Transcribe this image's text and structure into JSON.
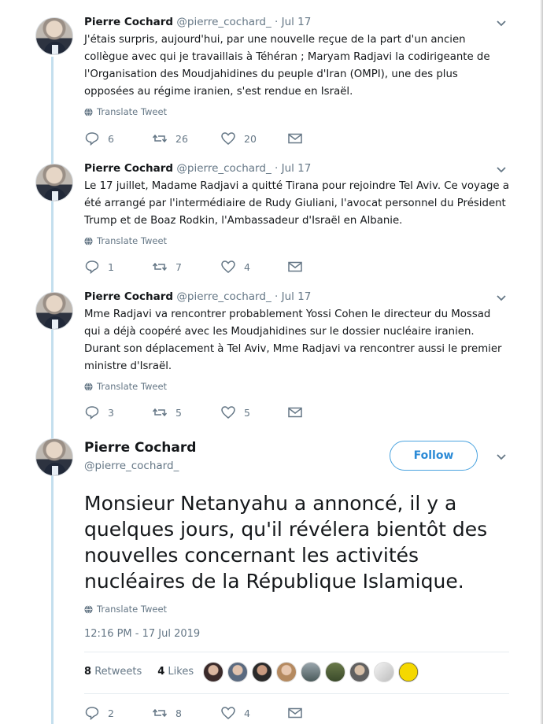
{
  "tweets": [
    {
      "name": "Pierre Cochard",
      "handle": "@pierre_cochard_",
      "date": "Jul 17",
      "text": "J'étais surpris, aujourd'hui, par une nouvelle reçue de la part d'un ancien collègue avec qui je travaillais à Téhéran ; Maryam Radjavi la codirigeante de l'Organisation des Moudjahidines du peuple d'Iran (OMPI), une des plus opposées au régime iranien, s'est rendue en Israël.",
      "translate": "Translate Tweet",
      "replies": "6",
      "retweets": "26",
      "likes": "20"
    },
    {
      "name": "Pierre Cochard",
      "handle": "@pierre_cochard_",
      "date": "Jul 17",
      "text": "Le 17 juillet, Madame Radjavi a quitté Tirana pour rejoindre Tel Aviv. Ce voyage a été arrangé par l'intermédiaire de Rudy Giuliani, l'avocat personnel du Président Trump et de Boaz Rodkin, l'Ambassadeur d'Israël en Albanie.",
      "translate": "Translate Tweet",
      "replies": "1",
      "retweets": "7",
      "likes": "4"
    },
    {
      "name": "Pierre Cochard",
      "handle": "@pierre_cochard_",
      "date": "Jul 17",
      "text": "Mme Radjavi va rencontrer probablement Yossi Cohen le directeur du Mossad qui a déjà coopéré avec les Moudjahidines sur le dossier nucléaire iranien. Durant son déplacement à Tel Aviv, Mme Radjavi va rencontrer aussi le premier ministre d'Israël.",
      "translate": "Translate Tweet",
      "replies": "3",
      "retweets": "5",
      "likes": "5"
    }
  ],
  "main": {
    "name": "Pierre Cochard",
    "handle": "@pierre_cochard_",
    "follow_label": "Follow",
    "text": "Monsieur Netanyahu a annoncé, il y a quelques jours, qu'il révélera bientôt des nouvelles concernant les activités nucléaires de la République Islamique.",
    "translate": "Translate Tweet",
    "timestamp": "12:16 PM - 17 Jul 2019",
    "retweets_count": "8",
    "retweets_label": "Retweets",
    "likes_count": "4",
    "likes_label": "Likes",
    "replies": "2",
    "retweets": "8",
    "likes": "4"
  },
  "colors": {
    "accent": "#1da1f2",
    "muted": "#657786",
    "thread_line": "#c4dfee"
  }
}
